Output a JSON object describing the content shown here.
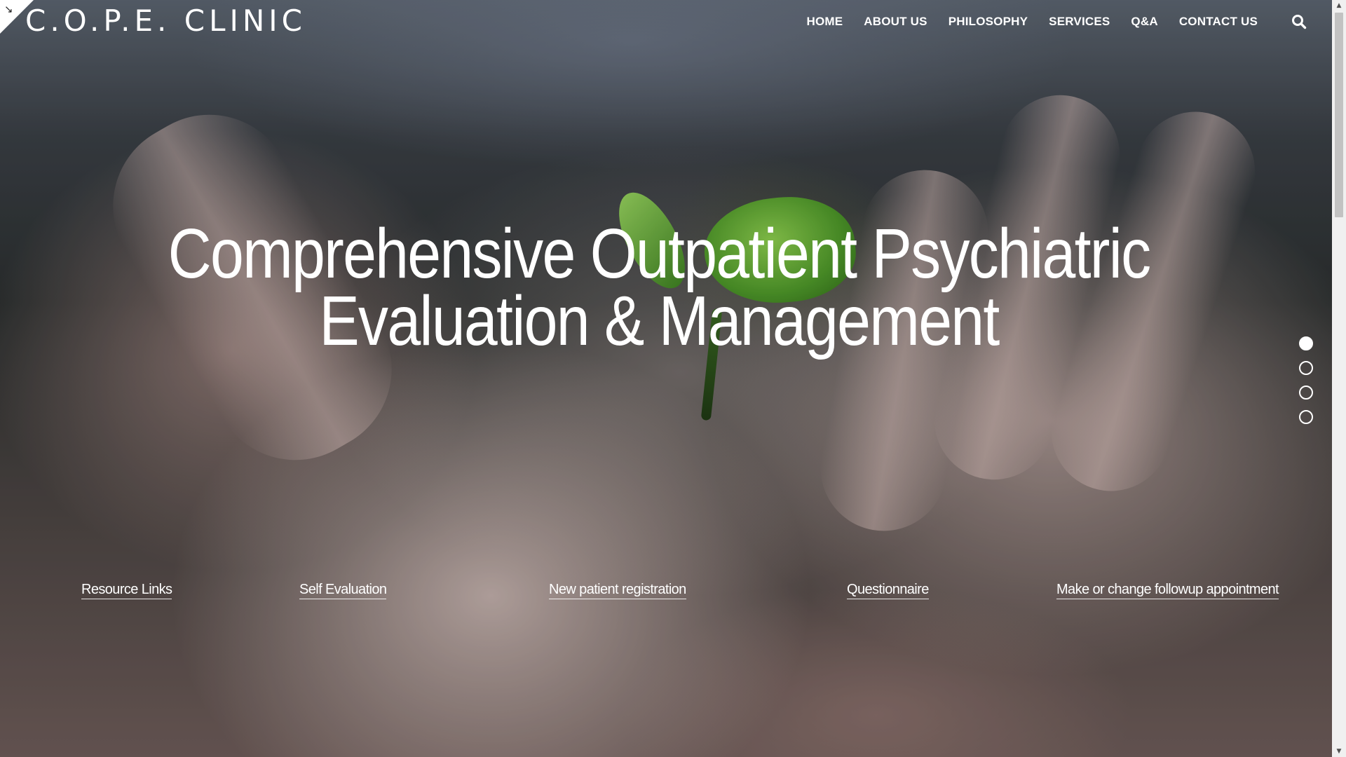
{
  "brand": {
    "logo_text": "C.O.P.E. CLINIC"
  },
  "corner_toggle": {
    "icon": "expand-arrow-icon"
  },
  "nav": {
    "items": [
      {
        "label": "HOME"
      },
      {
        "label": "ABOUT US"
      },
      {
        "label": "PHILOSOPHY"
      },
      {
        "label": "SERVICES"
      },
      {
        "label": "Q&A"
      },
      {
        "label": "CONTACT US"
      }
    ],
    "search_icon": "search-icon"
  },
  "hero": {
    "title_line1": "Comprehensive Outpatient Psychiatric",
    "title_line2": "Evaluation & Management",
    "background": "open hand holding a green sprout (blurred photo)"
  },
  "quick_links": [
    {
      "label": "Resource Links"
    },
    {
      "label": "Self Evaluation"
    },
    {
      "label": "New patient registration"
    },
    {
      "label": "Questionnaire"
    },
    {
      "label": "Make or change followup appointment"
    }
  ],
  "slider": {
    "total": 4,
    "active_index": 0
  },
  "colors": {
    "text": "#ffffff",
    "scrollbar_track": "#f0f0f0",
    "scrollbar_thumb": "#c2c2c2"
  }
}
